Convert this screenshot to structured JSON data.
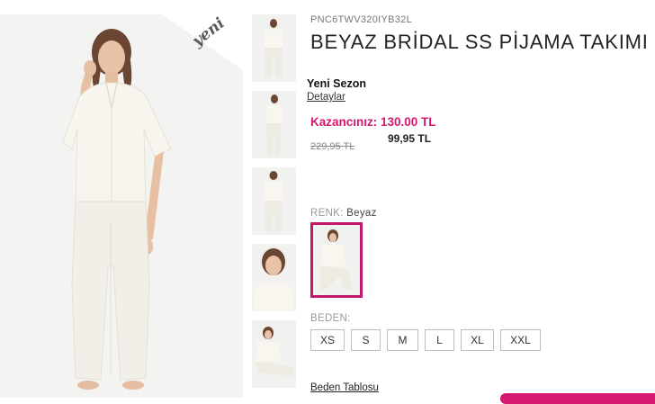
{
  "product": {
    "sku": "PNC6TWV320IYB32L",
    "title": "BEYAZ BRİDAL SS PİJAMA TAKIMI",
    "badge": "yeni",
    "season": "Yeni Sezon",
    "details_link": "Detaylar",
    "savings": "Kazancınız: 130.00 TL",
    "old_price": "229,95 TL",
    "new_price": "99,95 TL"
  },
  "color": {
    "label": "RENK:",
    "value": "Beyaz",
    "accent": "#c2186b"
  },
  "size": {
    "label": "BEDEN:",
    "options": [
      "XS",
      "S",
      "M",
      "L",
      "XL",
      "XXL"
    ]
  },
  "size_table_link": "Beden Tablosu",
  "thumbnails": [
    "thumb-front-full",
    "thumb-side-full",
    "thumb-back-full",
    "thumb-closeup",
    "thumb-seated"
  ],
  "colors": {
    "brand_pink": "#d4196f",
    "image_bg": "#f3f3f2"
  }
}
